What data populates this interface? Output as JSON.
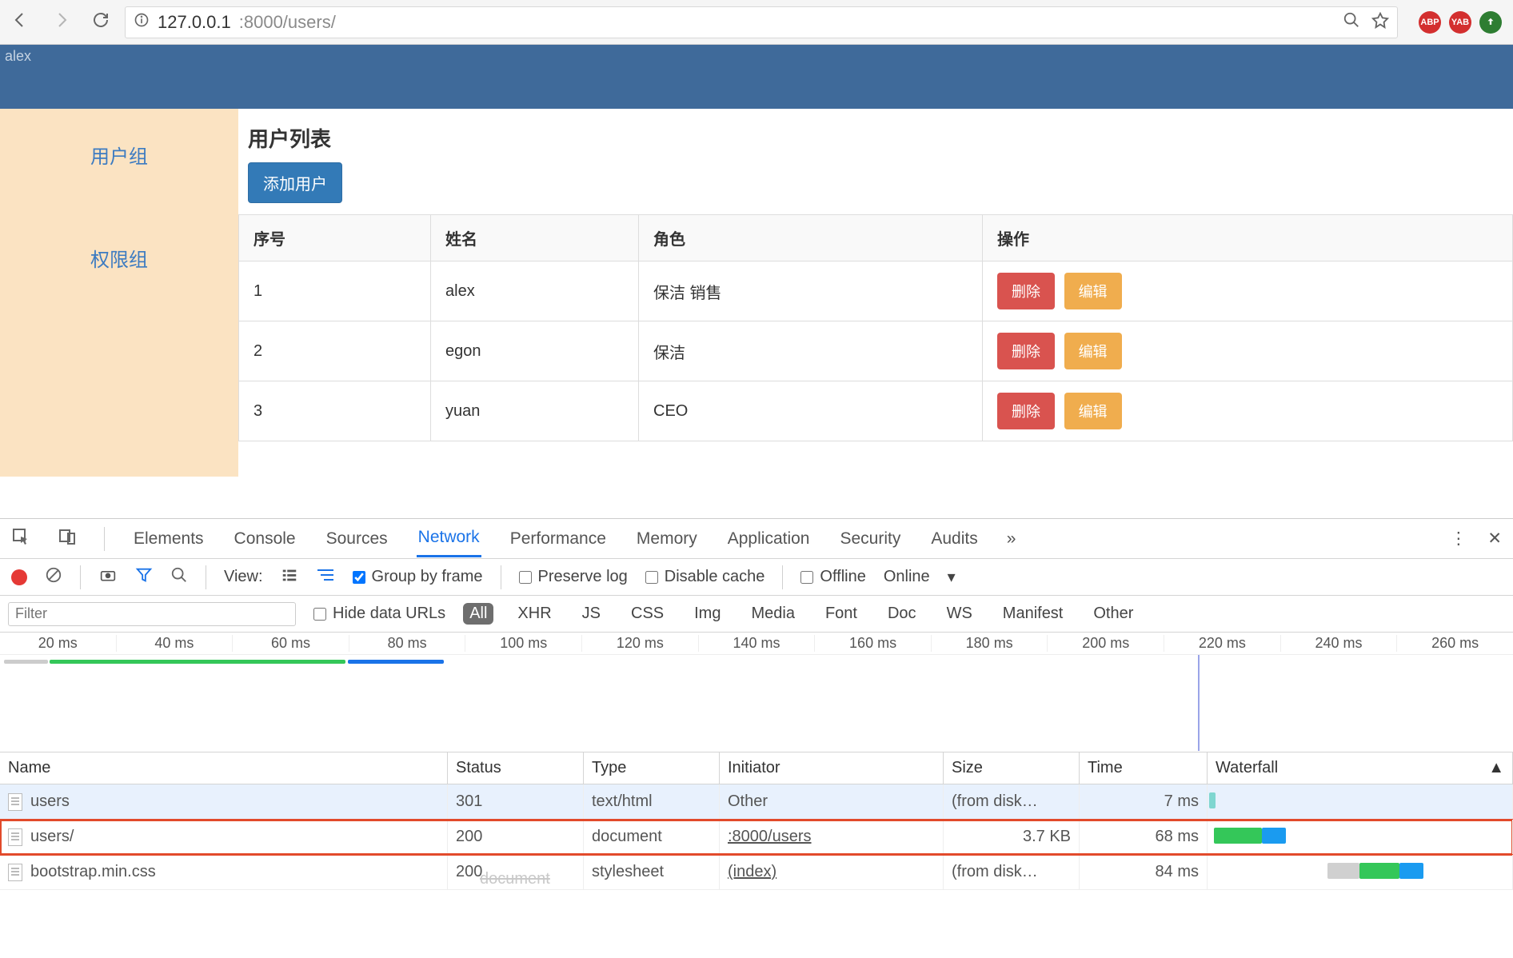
{
  "browser": {
    "url_host": "127.0.0.1",
    "url_port_path": ":8000/users/",
    "ext1": "ABP",
    "ext2": "YAB"
  },
  "app": {
    "header_user": "alex",
    "sidebar": {
      "item0": "用户组",
      "item1": "权限组"
    },
    "title": "用户列表",
    "add_btn": "添加用户",
    "cols": {
      "idx": "序号",
      "name": "姓名",
      "role": "角色",
      "ops": "操作"
    },
    "ops": {
      "del": "删除",
      "edit": "编辑"
    },
    "rows": [
      {
        "idx": "1",
        "name": "alex",
        "role": "保洁 销售"
      },
      {
        "idx": "2",
        "name": "egon",
        "role": "保洁"
      },
      {
        "idx": "3",
        "name": "yuan",
        "role": "CEO"
      }
    ]
  },
  "devtools": {
    "tabs": {
      "elements": "Elements",
      "console": "Console",
      "sources": "Sources",
      "network": "Network",
      "performance": "Performance",
      "memory": "Memory",
      "application": "Application",
      "security": "Security",
      "audits": "Audits"
    },
    "toolbar": {
      "view": "View:",
      "group": "Group by frame",
      "preserve": "Preserve log",
      "disable": "Disable cache",
      "offline": "Offline",
      "online": "Online"
    },
    "filter": {
      "placeholder": "Filter",
      "hide": "Hide data URLs",
      "all": "All",
      "xhr": "XHR",
      "js": "JS",
      "css": "CSS",
      "img": "Img",
      "media": "Media",
      "font": "Font",
      "doc": "Doc",
      "ws": "WS",
      "manifest": "Manifest",
      "other": "Other"
    },
    "ticks": [
      "20 ms",
      "40 ms",
      "60 ms",
      "80 ms",
      "100 ms",
      "120 ms",
      "140 ms",
      "160 ms",
      "180 ms",
      "200 ms",
      "220 ms",
      "240 ms",
      "260 ms"
    ],
    "cols": {
      "name": "Name",
      "status": "Status",
      "type": "Type",
      "initiator": "Initiator",
      "size": "Size",
      "time": "Time",
      "waterfall": "Waterfall"
    },
    "rows": [
      {
        "name": "users",
        "status": "301",
        "type": "text/html",
        "initiator": "Other",
        "size": "(from disk…",
        "time": "7 ms",
        "ini_link": false
      },
      {
        "name": "users/",
        "status": "200",
        "type": "document",
        "initiator": ":8000/users",
        "size": "3.7 KB",
        "time": "68 ms",
        "ini_link": true
      },
      {
        "name": "bootstrap.min.css",
        "status": "200",
        "type": "stylesheet",
        "initiator": "(index)",
        "size": "(from disk…",
        "time": "84 ms",
        "ini_link": true
      }
    ],
    "ghost": "document"
  }
}
